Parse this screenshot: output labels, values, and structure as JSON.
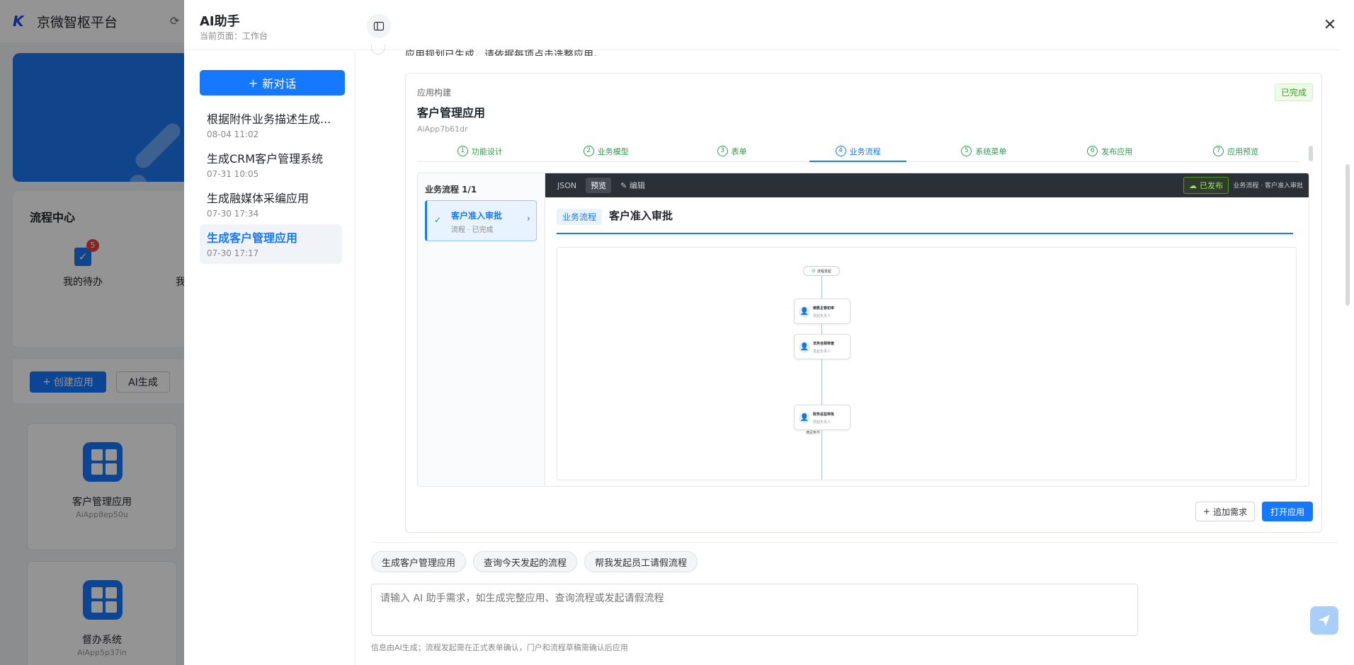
{
  "background": {
    "brand": "京微智枢平台",
    "flow_center": {
      "title": "流程中心",
      "todo_label": "我的待办",
      "todo_count": "5",
      "cut_label": "我"
    },
    "toolbar": {
      "create_label": "创建应用",
      "ai_label": "AI生成"
    },
    "apps": [
      {
        "name": "客户管理应用",
        "code": "AiApp8ep50u"
      },
      {
        "name": "督办系统",
        "code": "AiApp5p37in"
      }
    ]
  },
  "drawer": {
    "title": "AI助手",
    "subtitle": "当前页面：工作台"
  },
  "conversations": {
    "new_label": "新对话",
    "items": [
      {
        "title": "根据附件业务描述生成...",
        "date": "08-04 11:02"
      },
      {
        "title": "生成CRM客户管理系统",
        "date": "07-31 10:05"
      },
      {
        "title": "生成融媒体采编应用",
        "date": "07-30 17:34"
      },
      {
        "title": "生成客户管理应用",
        "date": "07-30 17:17"
      }
    ]
  },
  "message": {
    "cut_text": "应用规划已生成，请依据每项点击选整应用。"
  },
  "card": {
    "label": "应用构建",
    "name": "客户管理应用",
    "code": "AiApp7b61dr",
    "status": "已完成",
    "steps": [
      {
        "num": "1",
        "label": "功能设计"
      },
      {
        "num": "2",
        "label": "业务模型"
      },
      {
        "num": "3",
        "label": "表单"
      },
      {
        "num": "4",
        "label": "业务流程"
      },
      {
        "num": "5",
        "label": "系统菜单"
      },
      {
        "num": "6",
        "label": "发布应用"
      },
      {
        "num": "7",
        "label": "应用预览"
      }
    ],
    "active_step": 4,
    "flow_list": {
      "header": "业务流程 1/1",
      "item_name": "客户准入审批",
      "item_status": "流程 · 已完成"
    },
    "toolbar": {
      "json": "JSON",
      "preview": "预览",
      "edit": "编辑",
      "published": "已发布",
      "path": "业务流程 · 客户准入审批"
    },
    "preview": {
      "tag": "业务流程",
      "title": "客户准入审批",
      "start": "流程发起",
      "nodes": [
        {
          "name": "销售主管初审",
          "sub": "发起负责人"
        },
        {
          "name": "法务合规审查",
          "sub": "发起负责人"
        },
        {
          "name": "财务总监审批",
          "sub": "发起负责人"
        }
      ],
      "condition": "满足条件"
    },
    "actions": {
      "add": "追加需求",
      "open": "打开应用"
    }
  },
  "chips": [
    "生成客户管理应用",
    "查询今天发起的流程",
    "帮我发起员工请假流程"
  ],
  "input": {
    "placeholder": "请输入 AI 助手需求，如生成完整应用、查询流程或发起请假流程"
  },
  "footnote": "信息由AI生成；流程发起需在正式表单确认，门户和流程草稿需确认后应用",
  "colors": {
    "primary": "#1677ff",
    "success": "#3ba31b",
    "badge": "#e8423a"
  }
}
